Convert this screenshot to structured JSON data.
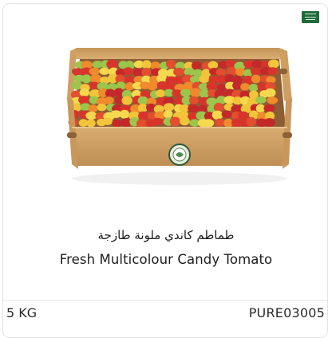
{
  "product": {
    "name_ar": "طماطم كاندي ملونة طازجة",
    "name_en": "Fresh Multicolour Candy Tomato",
    "weight": "5 KG",
    "sku": "PURE03005",
    "origin_flag": "flag-icon",
    "image_icon": "tomato-crate-image"
  },
  "colors": {
    "border": "#e4e4e4",
    "text": "#1d1d1d",
    "flag_green": "#1f6b3a",
    "crate": "#c99a5e"
  }
}
